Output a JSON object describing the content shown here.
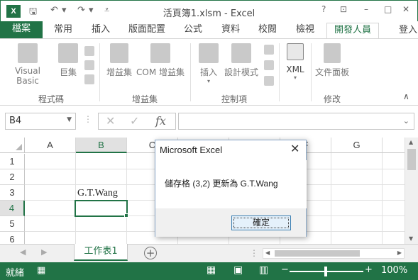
{
  "titlebar": {
    "logo": "X",
    "title": "活頁簿1.xlsm - Excel",
    "help": "?",
    "restore": "⊡",
    "minimize": "–",
    "maximize": "□",
    "close": "✕"
  },
  "tabs": {
    "file": "檔案",
    "items": [
      "常用",
      "插入",
      "版面配置",
      "公式",
      "資料",
      "校閱",
      "檢視",
      "開發人員"
    ],
    "active": "開發人員",
    "signin": "登入"
  },
  "ribbon": {
    "code": {
      "visual_basic": "Visual Basic",
      "macros": "巨集",
      "label": "程式碼"
    },
    "addins": {
      "addins": "增益集",
      "com_addins": "COM 增益集",
      "label": "增益集"
    },
    "controls": {
      "insert": "插入",
      "design_mode": "設計模式",
      "label": "控制項"
    },
    "xml": {
      "xml": "XML"
    },
    "modify": {
      "doc_panel": "文件面板",
      "label": "修改"
    }
  },
  "formula_bar": {
    "name_box": "B4",
    "fx": "fx",
    "formula": ""
  },
  "grid": {
    "columns": [
      "A",
      "B",
      "C",
      "D",
      "E",
      "F",
      "G"
    ],
    "selected_column": "B",
    "rows": [
      "1",
      "2",
      "3",
      "4",
      "5",
      "6"
    ],
    "selected_row": "4",
    "cells": [
      {
        "ref": "B3",
        "value": "G.T.Wang"
      }
    ]
  },
  "sheets": {
    "tabs": [
      "工作表1"
    ],
    "active": "工作表1"
  },
  "status": {
    "ready": "就緒",
    "zoom": "100%"
  },
  "dialog": {
    "title": "Microsoft Excel",
    "message": "儲存格 (3,2) 更新為 G.T.Wang",
    "ok": "確定",
    "close": "✕"
  },
  "colors": {
    "accent": "#217346"
  }
}
